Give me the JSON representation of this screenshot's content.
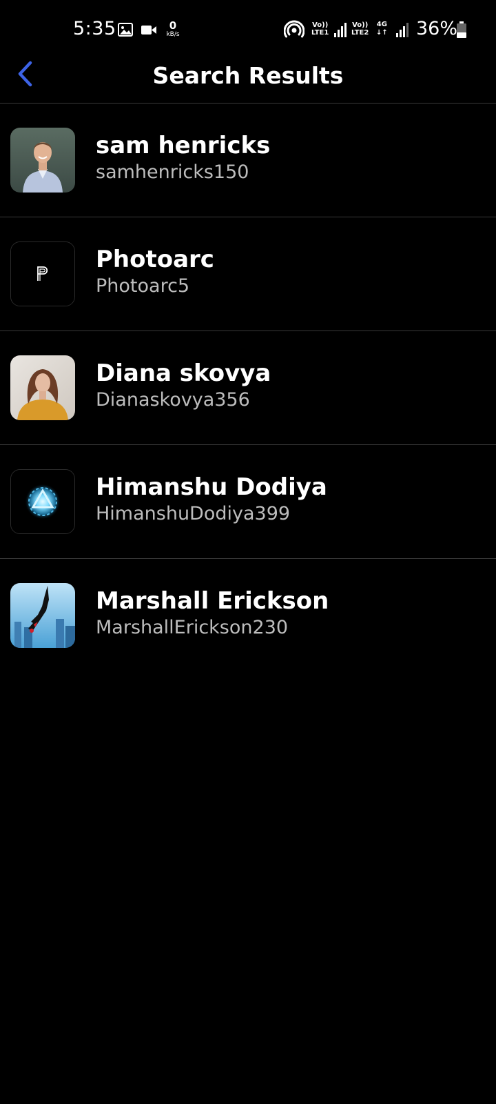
{
  "status_bar": {
    "time": "5:35",
    "net_speed_value": "0",
    "net_speed_unit": "kB/s",
    "sim1_line1": "Vo))",
    "sim1_line2": "LTE1",
    "sim2_line1": "Vo))",
    "sim2_line2": "LTE2",
    "network_type": "4G",
    "battery_percent": "36%",
    "battery_level": 0.36,
    "icons": [
      "gallery-icon",
      "video-icon",
      "hotspot-icon",
      "signal-icon",
      "battery-icon"
    ]
  },
  "header": {
    "title": "Search Results",
    "back_icon": "chevron-left-icon",
    "accent_color": "#3d63e6"
  },
  "results": [
    {
      "name": "sam henricks",
      "handle": "samhenricks150",
      "avatar": "photo-man-portrait"
    },
    {
      "name": "Photoarc",
      "handle": "Photoarc5",
      "avatar": "logo-p"
    },
    {
      "name": "Diana skovya",
      "handle": "Dianaskovya356",
      "avatar": "photo-woman-portrait"
    },
    {
      "name": "Himanshu Dodiya",
      "handle": "HimanshuDodiya399",
      "avatar": "arc-reactor"
    },
    {
      "name": "Marshall Erickson",
      "handle": "MarshallErickson230",
      "avatar": "spider-hero"
    }
  ]
}
